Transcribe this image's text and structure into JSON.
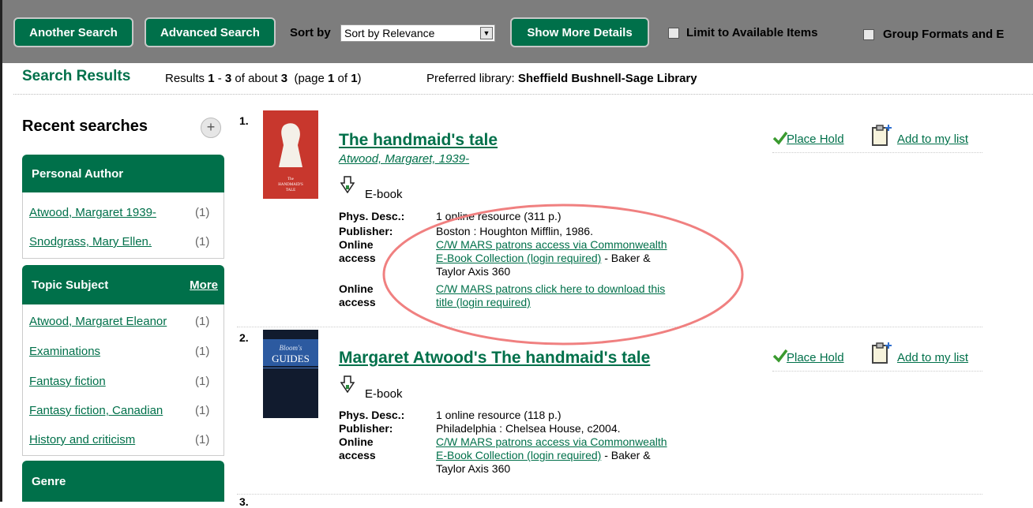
{
  "toolbar": {
    "another_search": "Another Search",
    "advanced_search": "Advanced Search",
    "sort_by_label": "Sort by",
    "sort_value": "Sort by Relevance",
    "show_more_details": "Show More Details",
    "limit_available": "Limit to Available Items",
    "group_formats": "Group Formats and E"
  },
  "results_header": {
    "title": "Search Results",
    "summary_prefix": "Results ",
    "range_start": "1",
    "range_sep": " - ",
    "range_end": "3",
    "about": " of about ",
    "total": "3",
    "page_prefix": "  (page ",
    "page": "1",
    "of": " of ",
    "pages": "1",
    "page_suffix": ")",
    "preferred_label": "Preferred library: ",
    "preferred_value": "Sheffield Bushnell-Sage Library"
  },
  "sidebar": {
    "recent_searches": "Recent searches",
    "plus": "+",
    "personal_author": {
      "title": "Personal Author",
      "items": [
        {
          "label": "Atwood, Margaret 1939-",
          "count": "(1)"
        },
        {
          "label": "Snodgrass, Mary Ellen.",
          "count": "(1)"
        }
      ]
    },
    "topic_subject": {
      "title": "Topic Subject",
      "more": "More",
      "items": [
        {
          "label": "Atwood, Margaret Eleanor",
          "count": "(1)"
        },
        {
          "label": "Examinations",
          "count": "(1)"
        },
        {
          "label": "Fantasy fiction",
          "count": "(1)"
        },
        {
          "label": "Fantasy fiction, Canadian",
          "count": "(1)"
        },
        {
          "label": "History and criticism",
          "count": "(1)"
        }
      ]
    },
    "genre": {
      "title": "Genre"
    }
  },
  "results": [
    {
      "num": "1.",
      "title": "The handmaid's tale",
      "author": "Atwood, Margaret, 1939-",
      "format": "E-book",
      "phys_label": "Phys. Desc.:",
      "phys": "1 online resource (311 p.)",
      "pub_label": "Publisher:",
      "pub": "Boston : Houghton Mifflin, 1986.",
      "online_label_1": "Online",
      "online_label_2": "access",
      "access1_link_a": "C/W MARS patrons access via Commonwealth",
      "access1_link_b": "E-Book Collection (login required)",
      "access1_suffix": " - Baker &",
      "access1_line3": "Taylor Axis 360",
      "access2_link_a": "C/W MARS patrons click here to download this",
      "access2_link_b": "title (login required)",
      "place_hold": "Place Hold",
      "add_to_list": "Add to my list"
    },
    {
      "num": "2.",
      "title": "Margaret Atwood's The handmaid's tale",
      "format": "E-book",
      "phys_label": "Phys. Desc.:",
      "phys": "1 online resource (118 p.)",
      "pub_label": "Publisher:",
      "pub": "Philadelphia : Chelsea House, c2004.",
      "online_label_1": "Online",
      "online_label_2": "access",
      "access1_link_a": "C/W MARS patrons access via Commonwealth",
      "access1_link_b": "E-Book Collection (login required)",
      "access1_suffix": " - Baker &",
      "access1_line3": "Taylor Axis 360",
      "place_hold": "Place Hold",
      "add_to_list": "Add to my list"
    },
    {
      "num": "3."
    }
  ],
  "covers": {
    "cover1_line1": "The",
    "cover1_line2": "HANDMAID'S",
    "cover1_line3": "TALE",
    "cover2_line1": "Bloom's",
    "cover2_line2": "GUIDES"
  },
  "colors": {
    "accent": "#00704a",
    "toolbar_bg": "#7d7d7d",
    "annotation": "#f08080"
  },
  "icons": {
    "hold": "checkmark-icon",
    "list": "clipboard-add-icon",
    "ebook": "download-arrow-icon"
  }
}
